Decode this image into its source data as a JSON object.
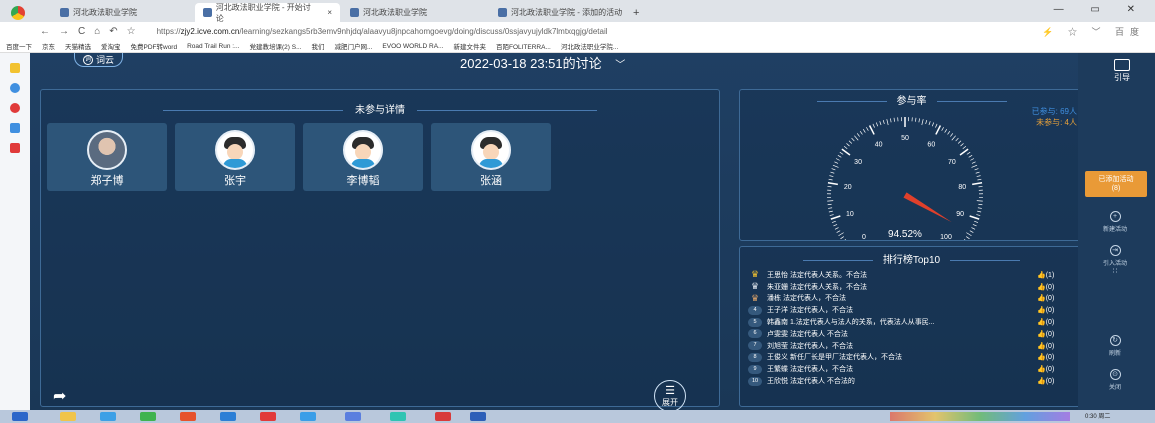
{
  "browser": {
    "tabs": [
      {
        "label": "河北政法职业学院",
        "active": false
      },
      {
        "label": "河北政法职业学院 - 开始讨论",
        "active": true
      },
      {
        "label": "河北政法职业学院",
        "active": false
      },
      {
        "label": "河北政法职业学院 - 添加的活动",
        "active": false
      }
    ],
    "new_tab": "+",
    "url_prefix": "https://",
    "url_host": "zjy2.icve.com.cn",
    "url_path": "/learning/sezkangs5rb3emv9nhjdq/alaavyu8jnpcahomgoevg/doing/discuss/0ssjavyujyldk7lmtxqgjg/detail",
    "search_engine": "百度",
    "bookmarks": [
      "百度一下",
      "京东",
      "天猫精选",
      "爱淘宝",
      "免费PDF转word",
      "Road Trail Run :...",
      "党建教培课(2) S...",
      "我们",
      "减肥门户网...",
      "EVOO WORLD RA...",
      "新建文件夹",
      "百陌FOLITERRA...",
      "河北政法职业学院..."
    ]
  },
  "app": {
    "logo_text": "词云",
    "logo_badge": "词",
    "discussion_title": "2022-03-18 23:51的讨论",
    "title_chevron": "﹀",
    "non_participants": {
      "title": "未参与详情",
      "people": [
        {
          "name": "郑子博",
          "avatar": "photo"
        },
        {
          "name": "张宇",
          "avatar": "cartoon"
        },
        {
          "name": "李博韬",
          "avatar": "cartoon"
        },
        {
          "name": "张涵",
          "avatar": "cartoon"
        }
      ]
    },
    "expand_label": "展开",
    "participation": {
      "title": "参与率",
      "joined_label": "已参与: 69人",
      "not_joined_label": "未参与: 4人",
      "rate_text": "94.52%",
      "rate_value": 94.52,
      "scale_labels": [
        "0",
        "10",
        "20",
        "30",
        "40",
        "50",
        "60",
        "70",
        "80",
        "90",
        "100"
      ]
    },
    "ranking": {
      "title": "排行榜Top10",
      "rows": [
        {
          "rank": "1",
          "text": "王思怡 法定代表人关系。不合法",
          "likes": "(1)"
        },
        {
          "rank": "2",
          "text": "朱亚姗 法定代表人关系，不合法",
          "likes": "(0)"
        },
        {
          "rank": "3",
          "text": "潘栋 法定代表人，不合法",
          "likes": "(0)"
        },
        {
          "rank": "4",
          "text": "王子洋 法定代表人，不合法",
          "likes": "(0)"
        },
        {
          "rank": "5",
          "text": "韩鑫南 1.法定代表人与法人的关系，代表法人从事民...",
          "likes": "(0)"
        },
        {
          "rank": "6",
          "text": "卢雯雯 法定代表人 不合法",
          "likes": "(0)"
        },
        {
          "rank": "7",
          "text": "刘旭莹 法定代表人，不合法",
          "likes": "(0)"
        },
        {
          "rank": "8",
          "text": "王俊义 新任厂长是甲厂法定代表人，不合法",
          "likes": "(0)"
        },
        {
          "rank": "9",
          "text": "王繁蝶 法定代表人，不合法",
          "likes": "(0)"
        },
        {
          "rank": "10",
          "text": "王欣悦 法定代表人 不合法的",
          "likes": "(0)"
        }
      ]
    }
  },
  "right_rail": {
    "guide_label": "引导",
    "added_activity": "已添加活动",
    "added_count": "(8)",
    "new_activity": "新建活动",
    "import_activity": "引入活动",
    "refresh": "刷新",
    "close": "关闭"
  },
  "colors": {
    "app_bg": "#1f3f63",
    "joined": "#3f8fe0",
    "not_joined": "#e8a13a",
    "needle": "#e0402b",
    "added_button": "#e99a37"
  },
  "taskbar": {
    "clock": "0:30 周二"
  }
}
